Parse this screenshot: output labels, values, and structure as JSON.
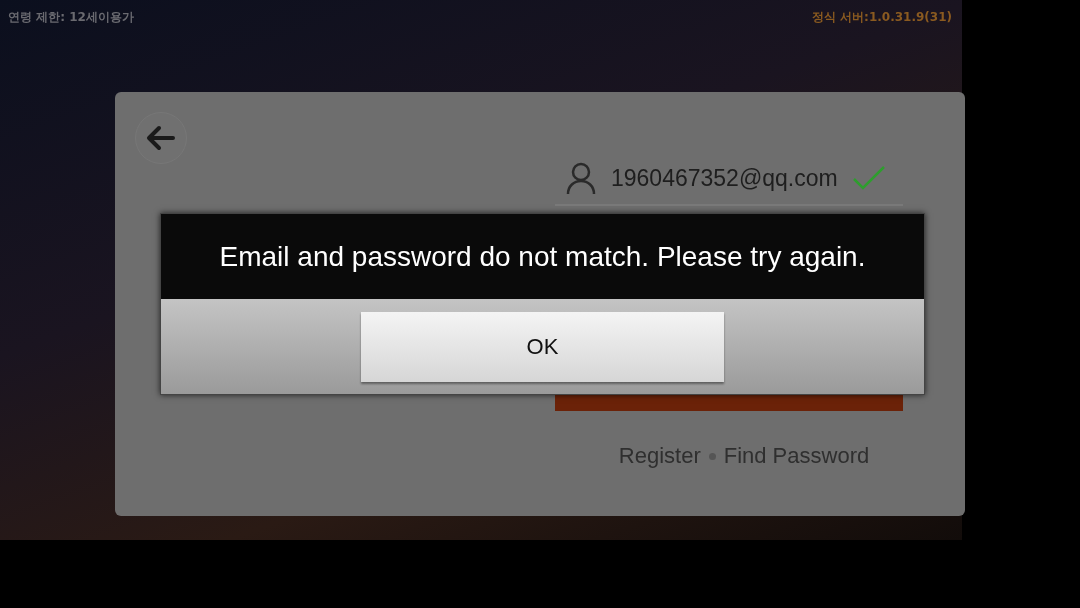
{
  "status": {
    "age_rating": "연령 제한: 12세이용가",
    "server": "정식 서버:1.0.31.9(31)"
  },
  "login": {
    "email": {
      "value": "1960467352@qq.com",
      "valid": true
    },
    "links": [
      "Register",
      "Find Password"
    ]
  },
  "dialog": {
    "message": "Email and password do not match. Please try again.",
    "buttons": [
      "OK"
    ]
  }
}
